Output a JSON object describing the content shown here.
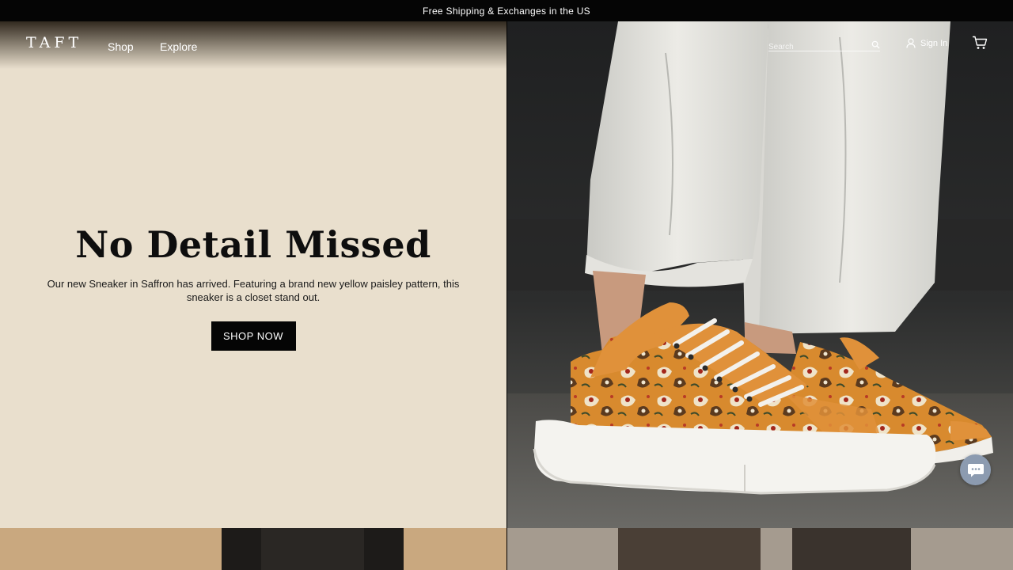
{
  "promo": {
    "text": "Free Shipping & Exchanges in the US"
  },
  "header": {
    "logo": "TAFT",
    "nav": [
      "Shop",
      "Explore"
    ],
    "search_placeholder": "Search",
    "signin_label": "Sign In"
  },
  "hero": {
    "title": "No Detail Missed",
    "subtitle": "Our new Sneaker in Saffron has arrived. Featuring a brand new yellow paisley pattern, this sneaker is a closet stand out.",
    "cta": "SHOP NOW",
    "image_alt": "saffron-paisley-sneaker-photo"
  },
  "colors": {
    "promo_bg": "#050505",
    "hero_left_bg": "#e9dfcd",
    "cta_bg": "#050505",
    "chat_bg": "#8c9bb0",
    "sneaker_orange": "#e0913a"
  }
}
